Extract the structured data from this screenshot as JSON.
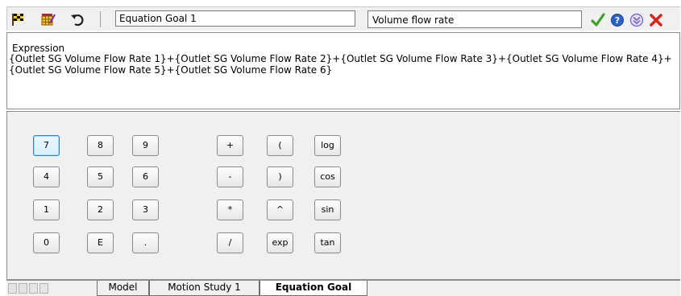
{
  "toolbar": {
    "icons": [
      "checkered-flag-icon",
      "edit-goal-icon",
      "undo-icon"
    ],
    "goal_name": "Equation Goal 1",
    "parameter": "Volume flow rate",
    "actions": [
      "ok-check-icon",
      "help-icon",
      "expand-icon",
      "close-icon"
    ],
    "colors": {
      "ok": "#3fa226",
      "help": "#2d63c8",
      "expand": "#7b6cc9",
      "close": "#d9261c"
    }
  },
  "expression": {
    "label": "Expression",
    "text": "{Outlet SG Volume Flow Rate 1}+{Outlet SG Volume Flow Rate 2}+{Outlet SG Volume Flow Rate 3}+{Outlet SG Volume Flow Rate 4}+{Outlet SG Volume Flow Rate 5}+{Outlet SG Volume Flow Rate 6}"
  },
  "keypad": {
    "digits": [
      "7",
      "8",
      "9",
      "4",
      "5",
      "6",
      "1",
      "2",
      "3",
      "0",
      "E",
      "."
    ],
    "operators": [
      "+",
      "(",
      "log",
      "-",
      ")",
      "cos",
      "*",
      "^",
      "sin",
      "/",
      "exp",
      "tan"
    ],
    "focused_key": "7"
  },
  "tabs": {
    "items": [
      "Model",
      "Motion Study 1",
      "Equation Goal"
    ],
    "active": "Equation Goal"
  }
}
